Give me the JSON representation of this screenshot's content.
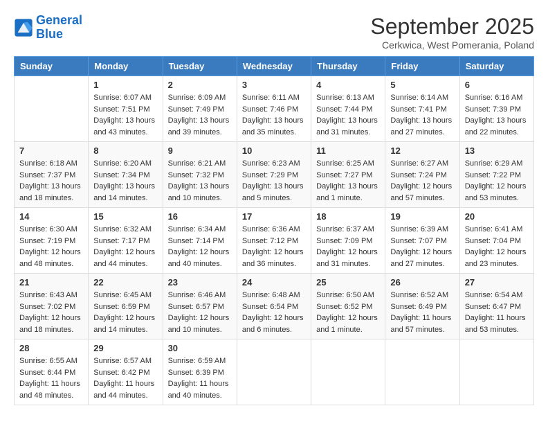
{
  "header": {
    "logo_line1": "General",
    "logo_line2": "Blue",
    "title": "September 2025",
    "subtitle": "Cerkwica, West Pomerania, Poland"
  },
  "columns": [
    "Sunday",
    "Monday",
    "Tuesday",
    "Wednesday",
    "Thursday",
    "Friday",
    "Saturday"
  ],
  "weeks": [
    [
      {
        "day": "",
        "info": ""
      },
      {
        "day": "1",
        "info": "Sunrise: 6:07 AM\nSunset: 7:51 PM\nDaylight: 13 hours\nand 43 minutes."
      },
      {
        "day": "2",
        "info": "Sunrise: 6:09 AM\nSunset: 7:49 PM\nDaylight: 13 hours\nand 39 minutes."
      },
      {
        "day": "3",
        "info": "Sunrise: 6:11 AM\nSunset: 7:46 PM\nDaylight: 13 hours\nand 35 minutes."
      },
      {
        "day": "4",
        "info": "Sunrise: 6:13 AM\nSunset: 7:44 PM\nDaylight: 13 hours\nand 31 minutes."
      },
      {
        "day": "5",
        "info": "Sunrise: 6:14 AM\nSunset: 7:41 PM\nDaylight: 13 hours\nand 27 minutes."
      },
      {
        "day": "6",
        "info": "Sunrise: 6:16 AM\nSunset: 7:39 PM\nDaylight: 13 hours\nand 22 minutes."
      }
    ],
    [
      {
        "day": "7",
        "info": "Sunrise: 6:18 AM\nSunset: 7:37 PM\nDaylight: 13 hours\nand 18 minutes."
      },
      {
        "day": "8",
        "info": "Sunrise: 6:20 AM\nSunset: 7:34 PM\nDaylight: 13 hours\nand 14 minutes."
      },
      {
        "day": "9",
        "info": "Sunrise: 6:21 AM\nSunset: 7:32 PM\nDaylight: 13 hours\nand 10 minutes."
      },
      {
        "day": "10",
        "info": "Sunrise: 6:23 AM\nSunset: 7:29 PM\nDaylight: 13 hours\nand 5 minutes."
      },
      {
        "day": "11",
        "info": "Sunrise: 6:25 AM\nSunset: 7:27 PM\nDaylight: 13 hours\nand 1 minute."
      },
      {
        "day": "12",
        "info": "Sunrise: 6:27 AM\nSunset: 7:24 PM\nDaylight: 12 hours\nand 57 minutes."
      },
      {
        "day": "13",
        "info": "Sunrise: 6:29 AM\nSunset: 7:22 PM\nDaylight: 12 hours\nand 53 minutes."
      }
    ],
    [
      {
        "day": "14",
        "info": "Sunrise: 6:30 AM\nSunset: 7:19 PM\nDaylight: 12 hours\nand 48 minutes."
      },
      {
        "day": "15",
        "info": "Sunrise: 6:32 AM\nSunset: 7:17 PM\nDaylight: 12 hours\nand 44 minutes."
      },
      {
        "day": "16",
        "info": "Sunrise: 6:34 AM\nSunset: 7:14 PM\nDaylight: 12 hours\nand 40 minutes."
      },
      {
        "day": "17",
        "info": "Sunrise: 6:36 AM\nSunset: 7:12 PM\nDaylight: 12 hours\nand 36 minutes."
      },
      {
        "day": "18",
        "info": "Sunrise: 6:37 AM\nSunset: 7:09 PM\nDaylight: 12 hours\nand 31 minutes."
      },
      {
        "day": "19",
        "info": "Sunrise: 6:39 AM\nSunset: 7:07 PM\nDaylight: 12 hours\nand 27 minutes."
      },
      {
        "day": "20",
        "info": "Sunrise: 6:41 AM\nSunset: 7:04 PM\nDaylight: 12 hours\nand 23 minutes."
      }
    ],
    [
      {
        "day": "21",
        "info": "Sunrise: 6:43 AM\nSunset: 7:02 PM\nDaylight: 12 hours\nand 18 minutes."
      },
      {
        "day": "22",
        "info": "Sunrise: 6:45 AM\nSunset: 6:59 PM\nDaylight: 12 hours\nand 14 minutes."
      },
      {
        "day": "23",
        "info": "Sunrise: 6:46 AM\nSunset: 6:57 PM\nDaylight: 12 hours\nand 10 minutes."
      },
      {
        "day": "24",
        "info": "Sunrise: 6:48 AM\nSunset: 6:54 PM\nDaylight: 12 hours\nand 6 minutes."
      },
      {
        "day": "25",
        "info": "Sunrise: 6:50 AM\nSunset: 6:52 PM\nDaylight: 12 hours\nand 1 minute."
      },
      {
        "day": "26",
        "info": "Sunrise: 6:52 AM\nSunset: 6:49 PM\nDaylight: 11 hours\nand 57 minutes."
      },
      {
        "day": "27",
        "info": "Sunrise: 6:54 AM\nSunset: 6:47 PM\nDaylight: 11 hours\nand 53 minutes."
      }
    ],
    [
      {
        "day": "28",
        "info": "Sunrise: 6:55 AM\nSunset: 6:44 PM\nDaylight: 11 hours\nand 48 minutes."
      },
      {
        "day": "29",
        "info": "Sunrise: 6:57 AM\nSunset: 6:42 PM\nDaylight: 11 hours\nand 44 minutes."
      },
      {
        "day": "30",
        "info": "Sunrise: 6:59 AM\nSunset: 6:39 PM\nDaylight: 11 hours\nand 40 minutes."
      },
      {
        "day": "",
        "info": ""
      },
      {
        "day": "",
        "info": ""
      },
      {
        "day": "",
        "info": ""
      },
      {
        "day": "",
        "info": ""
      }
    ]
  ]
}
